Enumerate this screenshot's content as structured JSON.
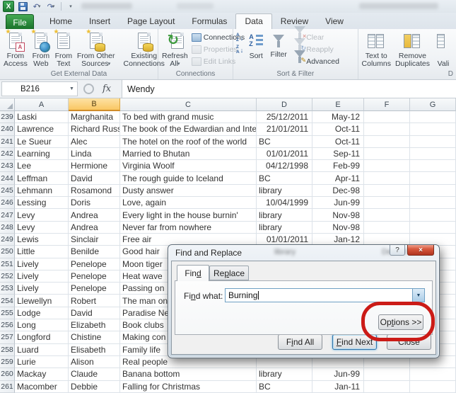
{
  "window": {
    "file_tab": "File",
    "ribbon_tabs": [
      "Home",
      "Insert",
      "Page Layout",
      "Formulas",
      "Data",
      "Review",
      "View"
    ],
    "active_tab": "Data"
  },
  "icons": {
    "excel_logo": "X",
    "help": "?",
    "close": "×",
    "dropdown": "▼",
    "menu_arrow": "▾",
    "undo": "↶",
    "redo": "↷",
    "refresh": "↻",
    "sparkle": "★",
    "sort_arrow": "↓",
    "letter_a": "A",
    "letter_z": "Z",
    "clear_x": "×",
    "pencil": "✎"
  },
  "ribbon": {
    "group_labels": {
      "get_external": "Get External Data",
      "connections": "Connections",
      "sort_filter": "Sort & Filter",
      "data_tools": "D"
    },
    "buttons": {
      "from_access": {
        "l1": "From",
        "l2": "Access"
      },
      "from_web": {
        "l1": "From",
        "l2": "Web"
      },
      "from_text": {
        "l1": "From",
        "l2": "Text"
      },
      "from_other": {
        "l1": "From Other",
        "l2": "Sources"
      },
      "existing_connections": {
        "l1": "Existing",
        "l2": "Connections"
      },
      "refresh_all": {
        "l1": "Refresh",
        "l2": "All"
      },
      "connections": "Connections",
      "properties": "Properties",
      "edit_links": "Edit Links",
      "sort": "Sort",
      "filter": "Filter",
      "clear": "Clear",
      "reapply": "Reapply",
      "advanced": "Advanced",
      "text_to_columns": {
        "l1": "Text to",
        "l2": "Columns"
      },
      "remove_duplicates": {
        "l1": "Remove",
        "l2": "Duplicates"
      },
      "validation": {
        "l1": "",
        "l2": "Vali"
      }
    }
  },
  "formula_bar": {
    "name_box": "B216",
    "fx_label": "fx",
    "value": "Wendy"
  },
  "sheet": {
    "columns": [
      "A",
      "B",
      "C",
      "D",
      "E",
      "F",
      "G"
    ],
    "selected_column": "B",
    "rows": [
      {
        "n": "239",
        "last": "Laski",
        "first": "Marghanita",
        "title": "To bed with grand music",
        "loc": "25/12/2011",
        "loc_date": true,
        "due": "May-12"
      },
      {
        "n": "240",
        "last": "Lawrence",
        "first": "Richard Russell",
        "title": "The book of the Edwardian and Inter-",
        "loc": "21/01/2011",
        "loc_date": true,
        "due": "Oct-11"
      },
      {
        "n": "241",
        "last": "Le Sueur",
        "first": "Alec",
        "title": "The hotel on the roof of the world",
        "loc": "BC",
        "loc_date": false,
        "due": "Oct-11"
      },
      {
        "n": "242",
        "last": "Learning",
        "first": "Linda",
        "title": "Married to Bhutan",
        "loc": "01/01/2011",
        "loc_date": true,
        "due": "Sep-11"
      },
      {
        "n": "243",
        "last": "Lee",
        "first": "Hermione",
        "title": "Virginia Woolf",
        "loc": "04/12/1998",
        "loc_date": true,
        "due": "Feb-99"
      },
      {
        "n": "244",
        "last": "Leffman",
        "first": "David",
        "title": "The rough guide to Iceland",
        "loc": "BC",
        "loc_date": false,
        "due": "Apr-11"
      },
      {
        "n": "245",
        "last": "Lehmann",
        "first": "Rosamond",
        "title": "Dusty answer",
        "loc": "library",
        "loc_date": false,
        "due": "Dec-98"
      },
      {
        "n": "246",
        "last": "Lessing",
        "first": "Doris",
        "title": "Love, again",
        "loc": "10/04/1999",
        "loc_date": true,
        "due": "Jun-99"
      },
      {
        "n": "247",
        "last": "Levy",
        "first": "Andrea",
        "title": "Every light in the house burnin'",
        "loc": "library",
        "loc_date": false,
        "due": "Nov-98"
      },
      {
        "n": "248",
        "last": "Levy",
        "first": "Andrea",
        "title": "Never far from nowhere",
        "loc": "library",
        "loc_date": false,
        "due": "Nov-98"
      },
      {
        "n": "249",
        "last": "Lewis",
        "first": "Sinclair",
        "title": "Free air",
        "loc": "01/01/2011",
        "loc_date": true,
        "due": "Jan-12"
      },
      {
        "n": "250",
        "last": "Little",
        "first": "Benilde",
        "title": "Good hair",
        "loc": "",
        "loc_date": false,
        "due": ""
      },
      {
        "n": "251",
        "last": "Lively",
        "first": "Penelope",
        "title": "Moon tiger",
        "loc": "",
        "loc_date": false,
        "due": ""
      },
      {
        "n": "252",
        "last": "Lively",
        "first": "Penelope",
        "title": "Heat wave",
        "loc": "",
        "loc_date": false,
        "due": ""
      },
      {
        "n": "253",
        "last": "Lively",
        "first": "Penelope",
        "title": "Passing on",
        "loc": "",
        "loc_date": false,
        "due": ""
      },
      {
        "n": "254",
        "last": "Llewellyn",
        "first": "Robert",
        "title": "The man on",
        "loc": "",
        "loc_date": false,
        "due": ""
      },
      {
        "n": "255",
        "last": "Lodge",
        "first": "David",
        "title": "Paradise Ne",
        "loc": "",
        "loc_date": false,
        "due": ""
      },
      {
        "n": "256",
        "last": "Long",
        "first": "Elizabeth",
        "title": "Book clubs",
        "loc": "",
        "loc_date": false,
        "due": ""
      },
      {
        "n": "257",
        "last": "Longford",
        "first": "Chistine",
        "title": "Making con",
        "loc": "",
        "loc_date": false,
        "due": ""
      },
      {
        "n": "258",
        "last": "Luard",
        "first": "Elisabeth",
        "title": "Family life",
        "loc": "",
        "loc_date": false,
        "due": ""
      },
      {
        "n": "259",
        "last": "Lurie",
        "first": "Alison",
        "title": "Real people",
        "loc": "",
        "loc_date": false,
        "due": ""
      },
      {
        "n": "260",
        "last": "Mackay",
        "first": "Claude",
        "title": "Banana bottom",
        "loc": "library",
        "loc_date": false,
        "due": "Jun-99"
      },
      {
        "n": "261",
        "last": "Macomber",
        "first": "Debbie",
        "title": "Falling for Christmas",
        "loc": "BC",
        "loc_date": false,
        "due": "Jan-11"
      }
    ]
  },
  "dialog": {
    "title": "Find and Replace",
    "ghost1": "library",
    "ghost2": "Dec-98",
    "tab_find": {
      "pre": "Fin",
      "u": "d",
      "post": ""
    },
    "tab_replace": {
      "pre": "Re",
      "u": "p",
      "post": "lace"
    },
    "find_what": {
      "pre": "Fi",
      "u": "n",
      "post": "d what:"
    },
    "input_value": "Burning",
    "options_btn": {
      "pre": "Op",
      "u": "t",
      "post": "ions >>"
    },
    "find_all_btn": {
      "pre": "F",
      "u": "i",
      "post": "nd All"
    },
    "find_next_btn": {
      "pre": "",
      "u": "F",
      "post": "ind Next"
    },
    "close_btn": "Close",
    "annotation_color": "#cb1b17"
  }
}
